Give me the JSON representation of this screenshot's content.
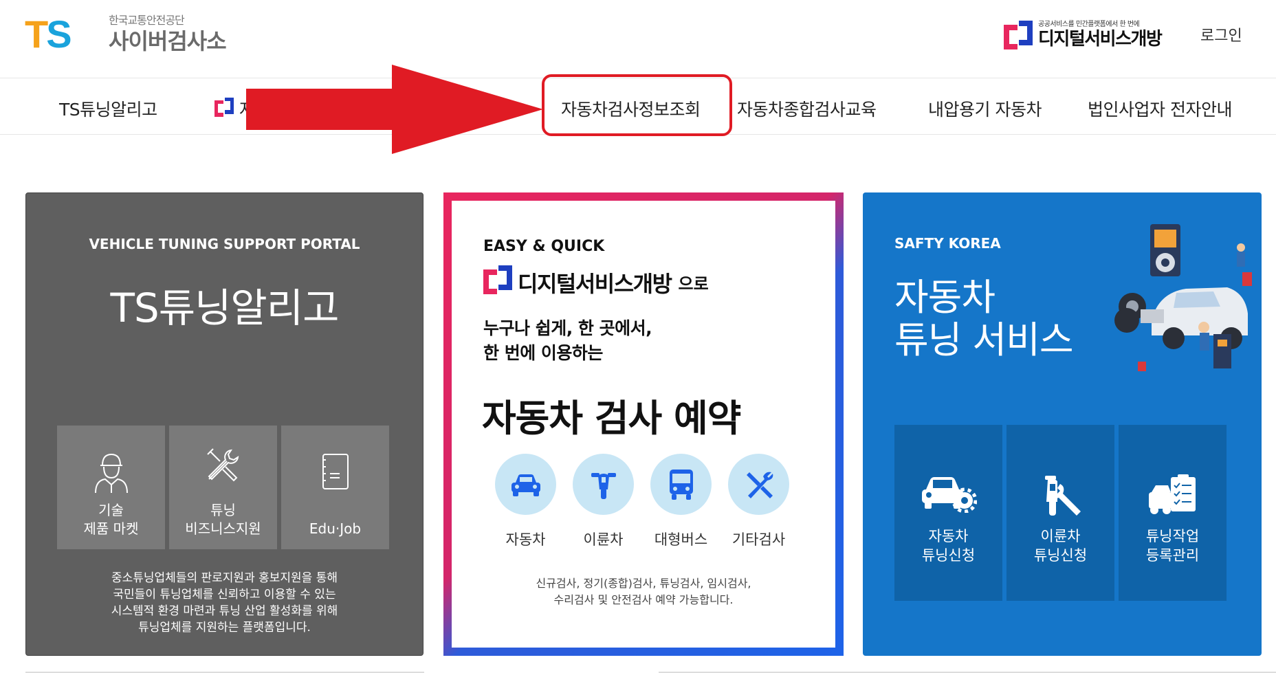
{
  "header": {
    "logo_mark_t": "T",
    "logo_mark_s": "S",
    "org_name": "한국교통안전공단",
    "site_name": "사이버검사소",
    "dsv_tagline": "공공서비스를 민간플랫폼에서 한 번에",
    "dsv_name": "디지털서비스개방",
    "login_label": "로그인"
  },
  "nav": {
    "items": [
      {
        "label": "TS튜닝알리고"
      },
      {
        "label": "자"
      },
      {
        "label": "자동차검사정보조회"
      },
      {
        "label": "자동차종합검사교육"
      },
      {
        "label": "내압용기 자동차"
      },
      {
        "label": "법인사업자 전자안내"
      }
    ]
  },
  "annotation": {
    "arrow_color": "#e01b24",
    "highlight_color": "#e01b24"
  },
  "card_gray": {
    "subtitle": "VEHICLE TUNING SUPPORT PORTAL",
    "title": "TS튜닝알리고",
    "tiles": [
      {
        "label": "기술\n제품 마켓",
        "icon": "worker-icon"
      },
      {
        "label": "튜닝\n비즈니스지원",
        "icon": "tools-icon"
      },
      {
        "label": "Edu·Job",
        "icon": "document-icon"
      }
    ],
    "description": "중소튜닝업체들의 판로지원과 홍보지원을 통해\n국민들이 튜닝업체를 신뢰하고 이용할 수 있는\n시스템적 환경 마련과 튜닝 산업 활성화를 위해\n튜닝업체를 지원하는 플랫폼입니다."
  },
  "card_easy": {
    "subtitle": "EASY & QUICK",
    "brand": "디지털서비스개방",
    "brand_suffix": "으로",
    "line1": "누구나 쉽게, 한 곳에서,",
    "line2": "한 번에 이용하는",
    "title": "자동차 검사 예약",
    "options": [
      {
        "label": "자동차",
        "icon": "car-icon"
      },
      {
        "label": "이륜차",
        "icon": "motorcycle-icon"
      },
      {
        "label": "대형버스",
        "icon": "bus-icon"
      },
      {
        "label": "기타검사",
        "icon": "wrench-icon"
      }
    ],
    "description": "신규검사, 정기(종합)검사, 튜닝검사, 임시검사,\n수리검사 및 안전검사 예약 가능합니다."
  },
  "card_blue": {
    "subtitle": "SAFTY KOREA",
    "title": "자동차\n튜닝 서비스",
    "tiles": [
      {
        "label": "자동차\n튜닝신청",
        "icon": "car-gear-icon"
      },
      {
        "label": "이륜차\n튜닝신청",
        "icon": "scooter-wrench-icon"
      },
      {
        "label": "튜닝작업\n등록관리",
        "icon": "truck-checklist-icon"
      }
    ]
  }
}
